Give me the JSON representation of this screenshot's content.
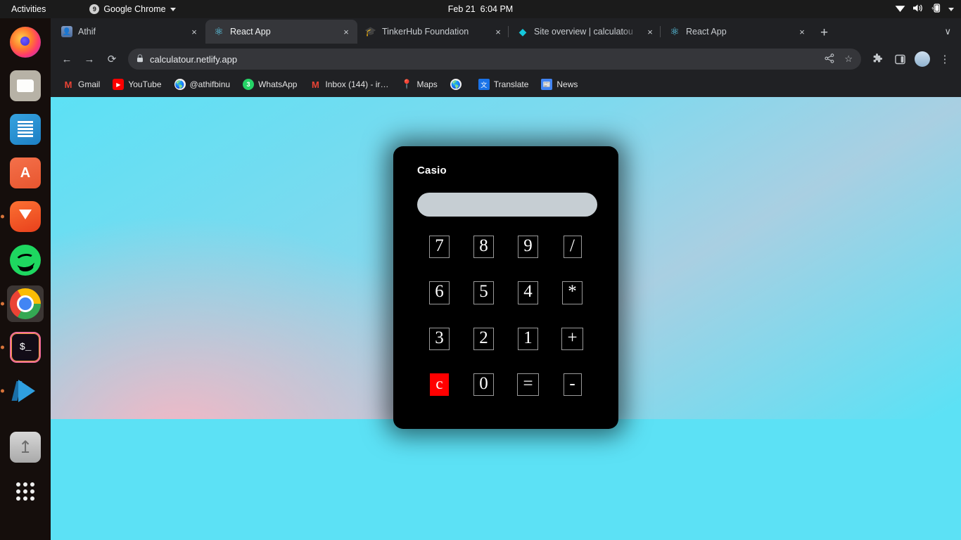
{
  "desktop": {
    "activities": "Activities",
    "app_menu": {
      "label": "Google Chrome",
      "icon": "chrome-icon"
    },
    "clock": {
      "date": "Feb 21",
      "time": "6:04 PM"
    },
    "tray": {
      "wifi": "wifi-icon",
      "volume": "volume-icon",
      "battery": "battery-charging-icon",
      "menu": "chevron-down-icon"
    }
  },
  "dock": {
    "items": [
      {
        "name": "firefox",
        "label": "Firefox",
        "running": false,
        "active": false
      },
      {
        "name": "files",
        "label": "Files",
        "running": false,
        "active": false
      },
      {
        "name": "writer",
        "label": "LibreOffice Writer",
        "running": false,
        "active": false
      },
      {
        "name": "software",
        "label": "Ubuntu Software",
        "running": false,
        "active": false
      },
      {
        "name": "brave",
        "label": "Brave Browser",
        "running": true,
        "active": false
      },
      {
        "name": "spotify",
        "label": "Spotify",
        "running": false,
        "active": false
      },
      {
        "name": "chrome",
        "label": "Google Chrome",
        "running": true,
        "active": true
      },
      {
        "name": "terminal",
        "label": "Terminal",
        "running": true,
        "active": false
      },
      {
        "name": "vscode",
        "label": "Visual Studio Code",
        "running": true,
        "active": false
      },
      {
        "name": "usb",
        "label": "USB Drive",
        "running": false,
        "active": false
      },
      {
        "name": "apps",
        "label": "Show Applications",
        "running": false,
        "active": false
      }
    ]
  },
  "browser": {
    "tabs": [
      {
        "title": "Athif",
        "favicon": "photo-favicon",
        "active": false,
        "close": "×"
      },
      {
        "title": "React App",
        "favicon": "react-favicon",
        "active": true,
        "close": "×"
      },
      {
        "title": "TinkerHub Foundation",
        "favicon": "graduation-cap-favicon",
        "active": false,
        "close": "×"
      },
      {
        "title": "Site overview | calculatou",
        "favicon": "diamond-favicon",
        "active": false,
        "close": "×"
      },
      {
        "title": "React App",
        "favicon": "react-favicon",
        "active": false,
        "close": "×"
      }
    ],
    "new_tab": "+",
    "tab_list": "∨",
    "nav": {
      "back": "←",
      "forward": "→",
      "reload": "⟳"
    },
    "omnibox": {
      "url": "calculatour.netlify.app",
      "lock": "🔒"
    },
    "omnibox_actions": {
      "share": "share-icon",
      "bookmark": "☆"
    },
    "toolbar_actions": {
      "extensions": "puzzle-icon",
      "side_panel": "panel-icon",
      "profile": "avatar",
      "menu": "⋮"
    },
    "bookmarks": [
      {
        "label": "Gmail",
        "icon": "gmail-icon",
        "glyph": "M"
      },
      {
        "label": "YouTube",
        "icon": "youtube-icon",
        "glyph": "▶"
      },
      {
        "label": "@athifbinu",
        "icon": "globe-icon",
        "glyph": "🌐"
      },
      {
        "label": "WhatsApp",
        "icon": "whatsapp-icon",
        "glyph": "3"
      },
      {
        "label": "Inbox (144) - ir…",
        "icon": "gmail-icon",
        "glyph": "M"
      },
      {
        "label": "Maps",
        "icon": "maps-icon",
        "glyph": "📍"
      },
      {
        "label": "",
        "icon": "globe-icon",
        "glyph": "🌐"
      },
      {
        "label": "Translate",
        "icon": "translate-icon",
        "glyph": "文"
      },
      {
        "label": "News",
        "icon": "news-icon",
        "glyph": "📰"
      }
    ]
  },
  "calculator": {
    "title": "Casio",
    "display_value": "",
    "display_placeholder": "",
    "keys": [
      {
        "label": "7",
        "kind": "digit"
      },
      {
        "label": "8",
        "kind": "digit"
      },
      {
        "label": "9",
        "kind": "digit"
      },
      {
        "label": "/",
        "kind": "operator"
      },
      {
        "label": "6",
        "kind": "digit"
      },
      {
        "label": "5",
        "kind": "digit"
      },
      {
        "label": "4",
        "kind": "digit"
      },
      {
        "label": "*",
        "kind": "operator"
      },
      {
        "label": "3",
        "kind": "digit"
      },
      {
        "label": "2",
        "kind": "digit"
      },
      {
        "label": "1",
        "kind": "digit"
      },
      {
        "label": "+",
        "kind": "operator"
      },
      {
        "label": "c",
        "kind": "clear"
      },
      {
        "label": "0",
        "kind": "digit"
      },
      {
        "label": "=",
        "kind": "equals"
      },
      {
        "label": "-",
        "kind": "operator"
      }
    ]
  },
  "colors": {
    "accent_cyan": "#5ce1f5",
    "accent_pink": "#f5b7c4",
    "clear_red": "#ff0000",
    "card_black": "#000000",
    "display_gray": "#c6ced3",
    "chrome_bg": "#202124",
    "tab_active_bg": "#35363a"
  }
}
